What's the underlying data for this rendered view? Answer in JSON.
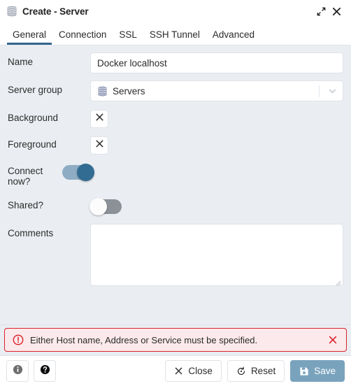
{
  "window": {
    "title": "Create - Server",
    "icon": "server-stack-icon",
    "maximize_icon": "maximize-icon",
    "close_icon": "close-icon"
  },
  "tabs": [
    {
      "label": "General",
      "active": true
    },
    {
      "label": "Connection",
      "active": false
    },
    {
      "label": "SSL",
      "active": false
    },
    {
      "label": "SSH Tunnel",
      "active": false
    },
    {
      "label": "Advanced",
      "active": false
    }
  ],
  "form": {
    "name": {
      "label": "Name",
      "value": "Docker localhost",
      "placeholder": ""
    },
    "server_group": {
      "label": "Server group",
      "value": "Servers",
      "icon": "server-stack-icon",
      "chevron": "chevron-down-icon"
    },
    "background": {
      "label": "Background",
      "swatch_icon": "x-icon",
      "value": ""
    },
    "foreground": {
      "label": "Foreground",
      "swatch_icon": "x-icon",
      "value": ""
    },
    "connect_now": {
      "label": "Connect now?",
      "state": "on"
    },
    "shared": {
      "label": "Shared?",
      "state": "off"
    },
    "comments": {
      "label": "Comments",
      "value": "",
      "placeholder": ""
    }
  },
  "alert": {
    "icon": "error-circle-icon",
    "message": "Either Host name, Address or Service must be specified.",
    "close_icon": "close-icon",
    "border_color": "#d9222a",
    "background_color": "#fbe9eb"
  },
  "footer": {
    "info_label": "",
    "info_icon": "info-icon",
    "help_label": "",
    "help_icon": "help-icon",
    "close_label": "Close",
    "close_icon": "x-icon",
    "reset_label": "Reset",
    "reset_icon": "reset-icon",
    "save_label": "Save",
    "save_icon": "save-disk-icon",
    "save_enabled": false
  },
  "colors": {
    "accent": "#326690",
    "body_background": "#eaeef2",
    "panel": "#ffffff",
    "toggle_on_track": "#8eadc4",
    "toggle_on_knob": "#336c92",
    "toggle_off_track": "#8b9197",
    "save_button": "#79a3bd"
  }
}
